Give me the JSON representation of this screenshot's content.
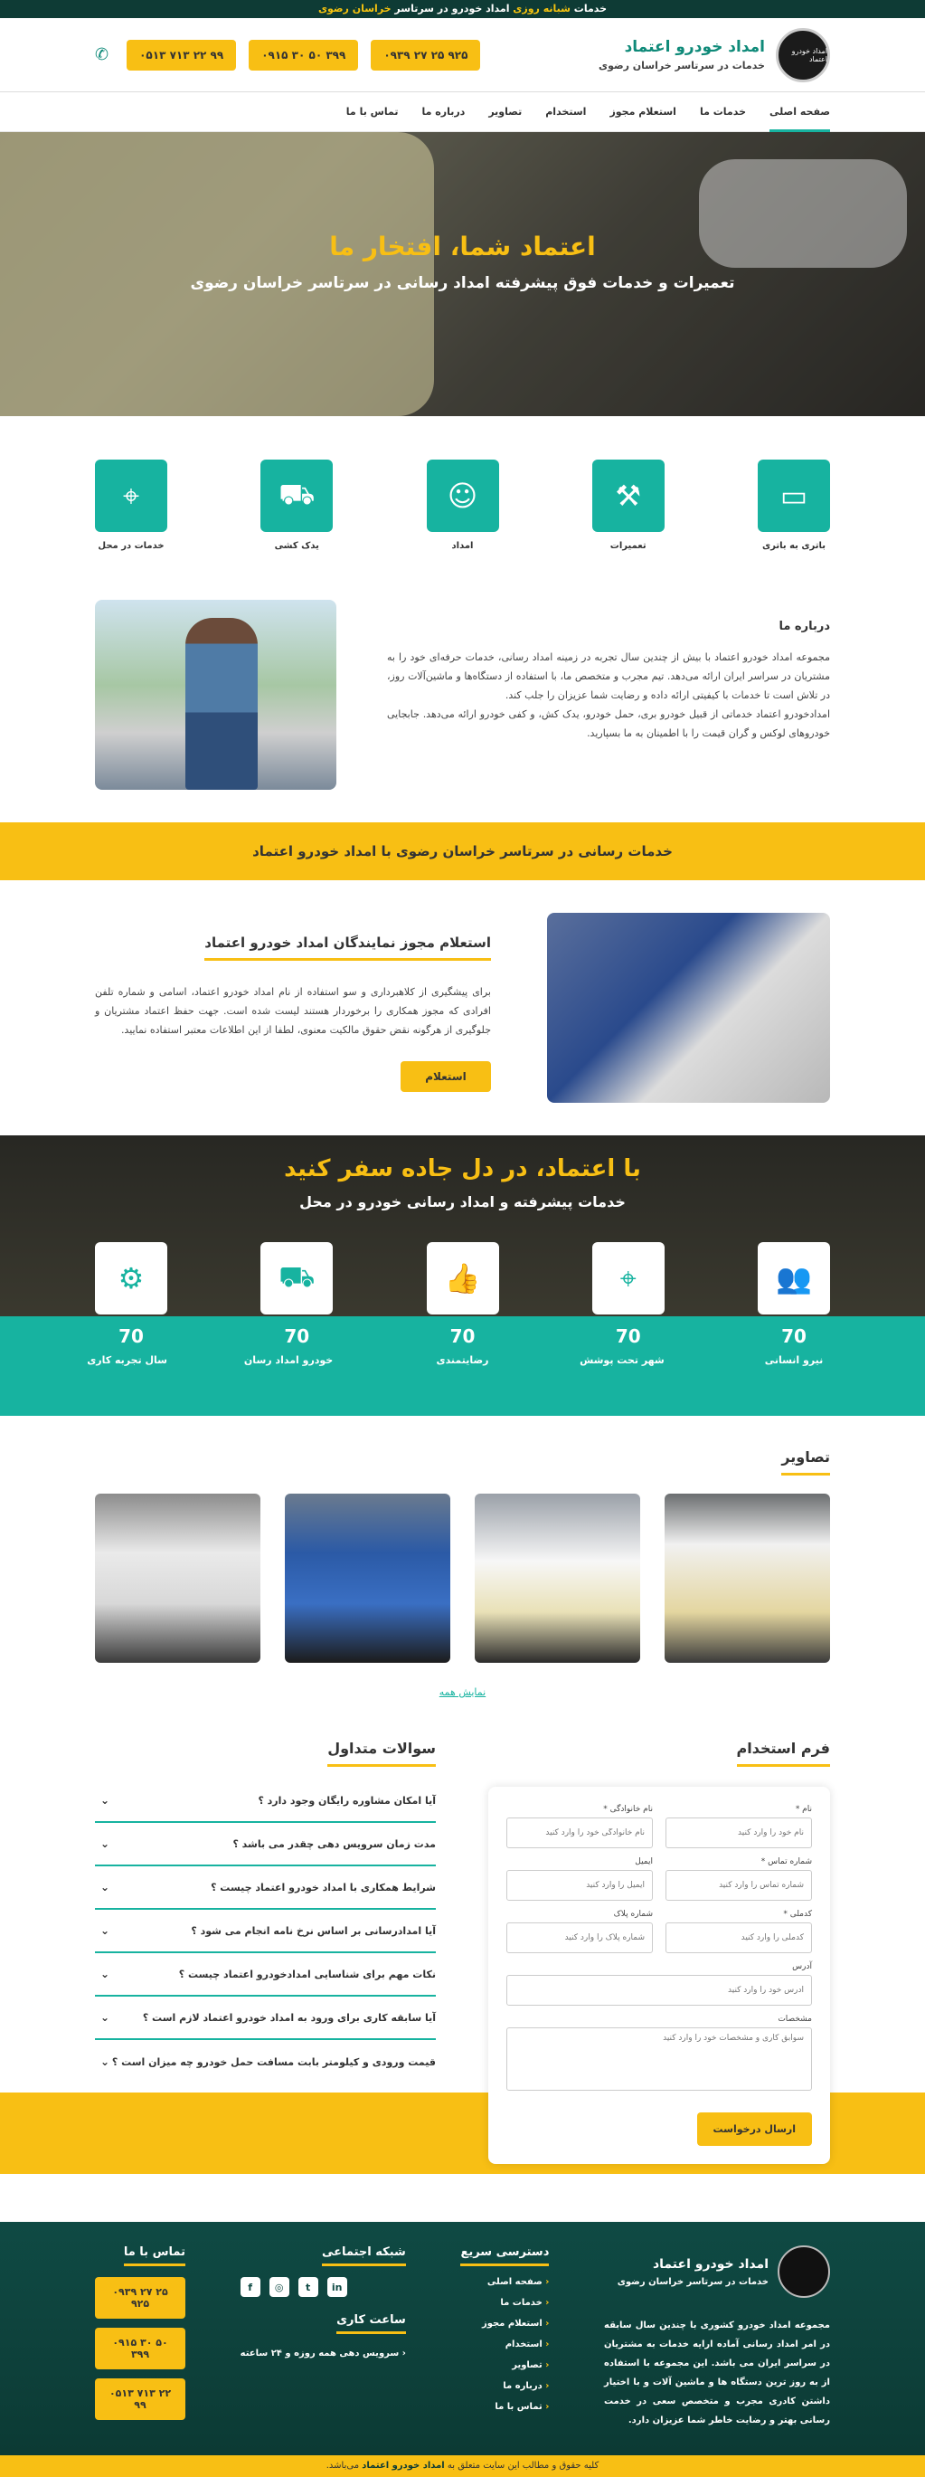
{
  "topbar": {
    "pre": "خدمات ",
    "highlight": "شبانه روزی",
    "post": " امداد خودرو در سرتاسر ",
    "region": "خراسان رضوی"
  },
  "brand": {
    "title": "امداد خودرو اعتماد",
    "subtitle": "خدمات در سرتاسر خراسان رضوی",
    "logo_text": "امداد خودرو اعتماد"
  },
  "header": {
    "phones": [
      "۰۹۳۹ ۲۷ ۲۵ ۹۲۵",
      "۰۹۱۵ ۳۰ ۵۰ ۳۹۹",
      "۰۵۱۳ ۷۱۳ ۲۲ ۹۹"
    ],
    "phone_icon": "phone-icon"
  },
  "nav": {
    "items": [
      "صفحه اصلی",
      "خدمات ما",
      "استعلام مجوز",
      "استخدام",
      "تصاویر",
      "درباره ما",
      "تماس با ما"
    ]
  },
  "hero": {
    "title": "اعتماد شما، افتخار ما",
    "subtitle": "تعمیرات و خدمات فوق پیشرفته امداد رسانی در سرتاسر خراسان رضوی"
  },
  "services": [
    {
      "label": "باتری به باتری",
      "icon": "battery-icon"
    },
    {
      "label": "تعمیرات",
      "icon": "wrench-icon"
    },
    {
      "label": "امداد",
      "icon": "mechanic-icon"
    },
    {
      "label": "یدک کشی",
      "icon": "tow-car-icon"
    },
    {
      "label": "خدمات در محل",
      "icon": "location-pin-icon"
    }
  ],
  "about": {
    "title": "درباره ما",
    "p1": "مجموعه امداد خودرو اعتماد با بیش از چندین سال تجربه در زمینه امداد رسانی، خدمات حرفه‌ای خود را به مشتریان در سراسر ایران ارائه می‌دهد. تیم مجرب و متخصص ما، با استفاده از دستگاه‌ها و ماشین‌آلات روز، در تلاش است تا خدمات با کیفیتی ارائه داده و رضایت شما عزیزان را جلب کند.",
    "p2": "امدادخودرو اعتماد خدماتی از قبیل خودرو بری، حمل خودرو، یدک کش، و کفی خودرو ارائه می‌دهد. جابجایی خودروهای لوکس و گران قیمت را با اطمینان به ما بسپارید."
  },
  "banner": {
    "text": "خدمات رسانی در سرتاسر خراسان رضوی با امداد خودرو اعتماد"
  },
  "inquiry": {
    "title": "استعلام مجوز نمایندگان امداد خودرو اعتماد",
    "text": "برای پیشگیری از کلاهبرداری و سو استفاده از نام امداد خودرو اعتماد، اسامی و شماره تلفن افرادی که مجوز همکاری را برخوردار هستند لیست شده است. جهت حفظ اعتماد مشتریان و جلوگیری از هرگونه نقض حقوق مالکیت معنوی، لطفا از این اطلاعات معتبر استفاده نمایید.",
    "button": "استعلام"
  },
  "stats": {
    "title": "با اعتماد، در دل جاده سفر کنید",
    "subtitle": "خدمات پیشرفته و امداد رسانی خودرو در محل",
    "items": [
      {
        "num": "70",
        "label": "نیرو انسانی",
        "icon": "people-icon"
      },
      {
        "num": "70",
        "label": "شهر تحت پوشش",
        "icon": "map-pin-icon"
      },
      {
        "num": "70",
        "label": "رضایتمندی",
        "icon": "thumbs-up-icon"
      },
      {
        "num": "70",
        "label": "خودرو امداد رسان",
        "icon": "tow-truck-icon"
      },
      {
        "num": "70",
        "label": "سال تجربه کاری",
        "icon": "mechanic-tools-icon"
      }
    ]
  },
  "gallery": {
    "title": "تصاویر",
    "show_all": "نمایش همه"
  },
  "form": {
    "title": "فرم استخدام",
    "fields": {
      "name": {
        "label": "نام *",
        "placeholder": "نام خود را وارد کنید"
      },
      "family": {
        "label": "نام خانوادگی *",
        "placeholder": "نام خانوادگی خود را وارد کنید"
      },
      "phone": {
        "label": "شماره تماس *",
        "placeholder": "شماره تماس را وارد کنید"
      },
      "email": {
        "label": "ایمیل",
        "placeholder": "ایمیل را وارد کنید"
      },
      "code": {
        "label": "کدملی *",
        "placeholder": "کدملی را وارد کنید"
      },
      "plate": {
        "label": "شماره پلاک",
        "placeholder": "شماره پلاک را وارد کنید"
      },
      "address": {
        "label": "آدرس",
        "placeholder": "آدرس خود را وارد کنید"
      },
      "specs": {
        "label": "مشخصات",
        "placeholder": "سوابق کاری و مشخصات خود را وارد کنید"
      }
    },
    "submit": "ارسال درخواست"
  },
  "faq": {
    "title": "سوالات متداول",
    "items": [
      "آیا امکان مشاوره رایگان وجود دارد ؟",
      "مدت زمان سرویس دهی چقدر می باشد ؟",
      "شرایط همکاری با امداد خودرو اعتماد چیست ؟",
      "آیا امدادرسانی بر اساس نرخ نامه انجام می شود ؟",
      "نکات مهم برای شناسایی امدادخودرو اعتماد چیست ؟",
      "آیا سابقه کاری برای ورود به امداد خودرو اعتماد لازم است ؟",
      "قیمت ورودی و کیلومتر بابت مسافت حمل خودرو چه میزان است ؟"
    ]
  },
  "footer": {
    "brand_title": "امداد خودرو اعتماد",
    "brand_sub": "خدمات در سرتاسر خراسان رضوی",
    "desc": "مجموعه امداد خودرو کشوری با چندین سال سابقه در امر امداد رسانی آماده ارایه خدمات به مشتریان در سراسر ایران می باشد. این مجموعه با استفاده از به روز ترین دستگاه ها و ماشین آلات و با اختیار داشتن کادری مجرب و متخصص سعی در خدمت رسانی بهتر و رضایت خاطر شما عزیزان دارد.",
    "quick_title": "دسترسی سریع",
    "quick_links": [
      "صفحه اصلی",
      "خدمات ما",
      "استعلام مجوز",
      "استخدام",
      "تصاویر",
      "درباره ما",
      "تماس با ما"
    ],
    "social_title": "شبکه اجتماعی",
    "social": [
      "f",
      "◎",
      "t",
      "in"
    ],
    "hours_title": "ساعت کاری",
    "hours": "سرویس دهی همه روزه و ۲۴ ساعته",
    "contact_title": "تماس با ما",
    "phones": [
      "۰۹۳۹ ۲۷ ۲۵ ۹۲۵",
      "۰۹۱۵ ۳۰ ۵۰ ۳۹۹",
      "۰۵۱۳ ۷۱۳ ۲۲ ۹۹"
    ]
  },
  "copyright": {
    "pre": "کلیه حقوق و مطالب این سایت متعلق به ",
    "brand": "امداد خودرو اعتماد",
    "post": " می‌باشد."
  }
}
